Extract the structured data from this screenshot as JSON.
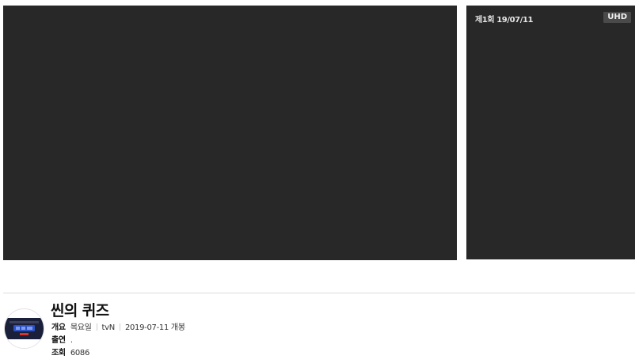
{
  "player": {},
  "playlist": {
    "episode_label": "제1회 19/07/11",
    "quality_badge": "UHD"
  },
  "program": {
    "title": "씬의 퀴즈",
    "overview_label": "개요",
    "day": "목요일",
    "channel": "tvN",
    "release": "2019-07-11 개봉",
    "cast_label": "출연",
    "cast_value": ".",
    "views_label": "조회",
    "views_value": "6086"
  },
  "colors": {
    "player_bg": "#282828",
    "badge_bg": "#4a4a4a",
    "avatar_dark": "#1a1f3a",
    "avatar_blue": "#2d52c4",
    "avatar_red": "#d9342b"
  }
}
